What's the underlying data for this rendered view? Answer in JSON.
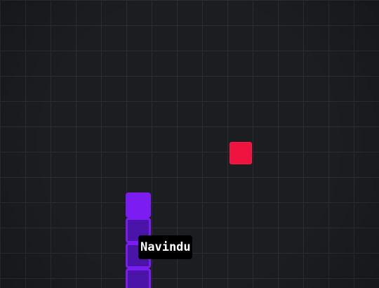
{
  "game": {
    "player": {
      "name": "Navindu",
      "color": "#7b1cf2",
      "body_color": "#4a14a8"
    },
    "food": {
      "color": "#f0123f"
    },
    "board": {
      "background": "#1b1d21",
      "grid_color": "#2a2d32"
    }
  }
}
